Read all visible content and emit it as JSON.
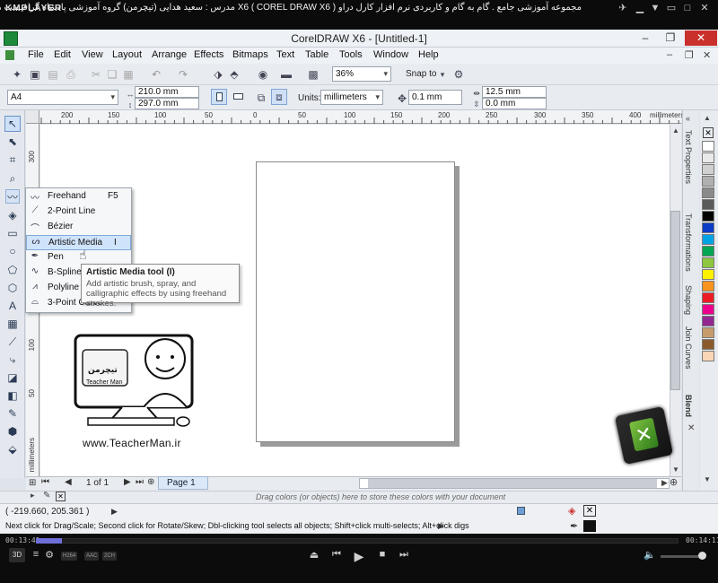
{
  "player": {
    "logo": "KMPLAYER",
    "video_title": "مجموعه آموزشی جامع . گام به گام و کاربردی نرم افزار کارل دراو  X6 ( COREL DRAW X6 )   مدرس : سعید هدایی (تیچرمن) گروه آموزشی پادشاه گرافیست ها",
    "time_elapsed": "00:13:41",
    "time_total": "00:14:11",
    "progress_fraction": 0.04,
    "badges": [
      "H264",
      "AAC",
      "2CH"
    ],
    "three_d": "3D"
  },
  "window": {
    "title": "CorelDRAW X6 - [Untitled-1]"
  },
  "menu": [
    "File",
    "Edit",
    "View",
    "Layout",
    "Arrange",
    "Effects",
    "Bitmaps",
    "Text",
    "Table",
    "Tools",
    "Window",
    "Help"
  ],
  "standard_toolbar": {
    "zoom": "36%",
    "snap_to": "Snap to"
  },
  "property_bar": {
    "paper_size": "A4",
    "width": "210.0 mm",
    "height": "297.0 mm",
    "units_label": "Units:",
    "units": "millimeters",
    "nudge": "0.1 mm",
    "dup_x": "12.5 mm",
    "dup_y": "0.0 mm"
  },
  "ruler": {
    "top_ticks": [
      "200",
      "150",
      "100",
      "50",
      "0",
      "50",
      "100",
      "150",
      "200",
      "250",
      "300",
      "350",
      "400"
    ],
    "top_unit": "millimeters",
    "left_ticks": [
      "300",
      "250",
      "150",
      "100",
      "50"
    ],
    "left_unit": "millimeters"
  },
  "flyout": {
    "items": [
      {
        "label": "Freehand",
        "key": "F5",
        "icon": "freehand-icon"
      },
      {
        "label": "2-Point Line",
        "key": "",
        "icon": "line-icon"
      },
      {
        "label": "Bézier",
        "key": "",
        "icon": "bezier-icon"
      },
      {
        "label": "Artistic Media",
        "key": "I",
        "icon": "artistic-media-icon"
      },
      {
        "label": "Pen",
        "key": "",
        "icon": "pen-icon"
      },
      {
        "label": "B-Spline",
        "key": "",
        "icon": "bspline-icon"
      },
      {
        "label": "Polyline",
        "key": "",
        "icon": "polyline-icon"
      },
      {
        "label": "3-Point Curve",
        "key": "",
        "icon": "curve-icon"
      }
    ]
  },
  "tooltip": {
    "title": "Artistic Media tool (I)",
    "description": "Add artistic brush, spray, and calligraphic effects by using freehand strokes."
  },
  "watermark": {
    "url": "www.TeacherMan.ir",
    "brand": "Teacher Man",
    "persian": "تیچرمن"
  },
  "page_nav": {
    "counter": "1 of 1",
    "tab": "Page 1"
  },
  "dockers": [
    "Text Properties",
    "Transformations",
    "Shaping",
    "Join Curves",
    "Blend"
  ],
  "palette": [
    "#ffffff",
    "#e9e9e9",
    "#d0d0d0",
    "#b0b0b0",
    "#8a8a8a",
    "#5a5a5a",
    "#000000",
    "#0a3cc8",
    "#00a4e4",
    "#00a651",
    "#8dc63f",
    "#fff200",
    "#f7941d",
    "#ed1c24",
    "#ec008c",
    "#92278f",
    "#c69c6d",
    "#8b5a2b",
    "#fbd5b5"
  ],
  "doc_palette_hint": "Drag colors (or objects) here to store these colors with your document",
  "status": {
    "coords": "( -219.660, 205.361 )",
    "hint": "Next click for Drag/Scale; Second click for Rotate/Skew; Dbl-clicking tool selects all objects; Shift+click multi-selects; Alt+click digs"
  }
}
